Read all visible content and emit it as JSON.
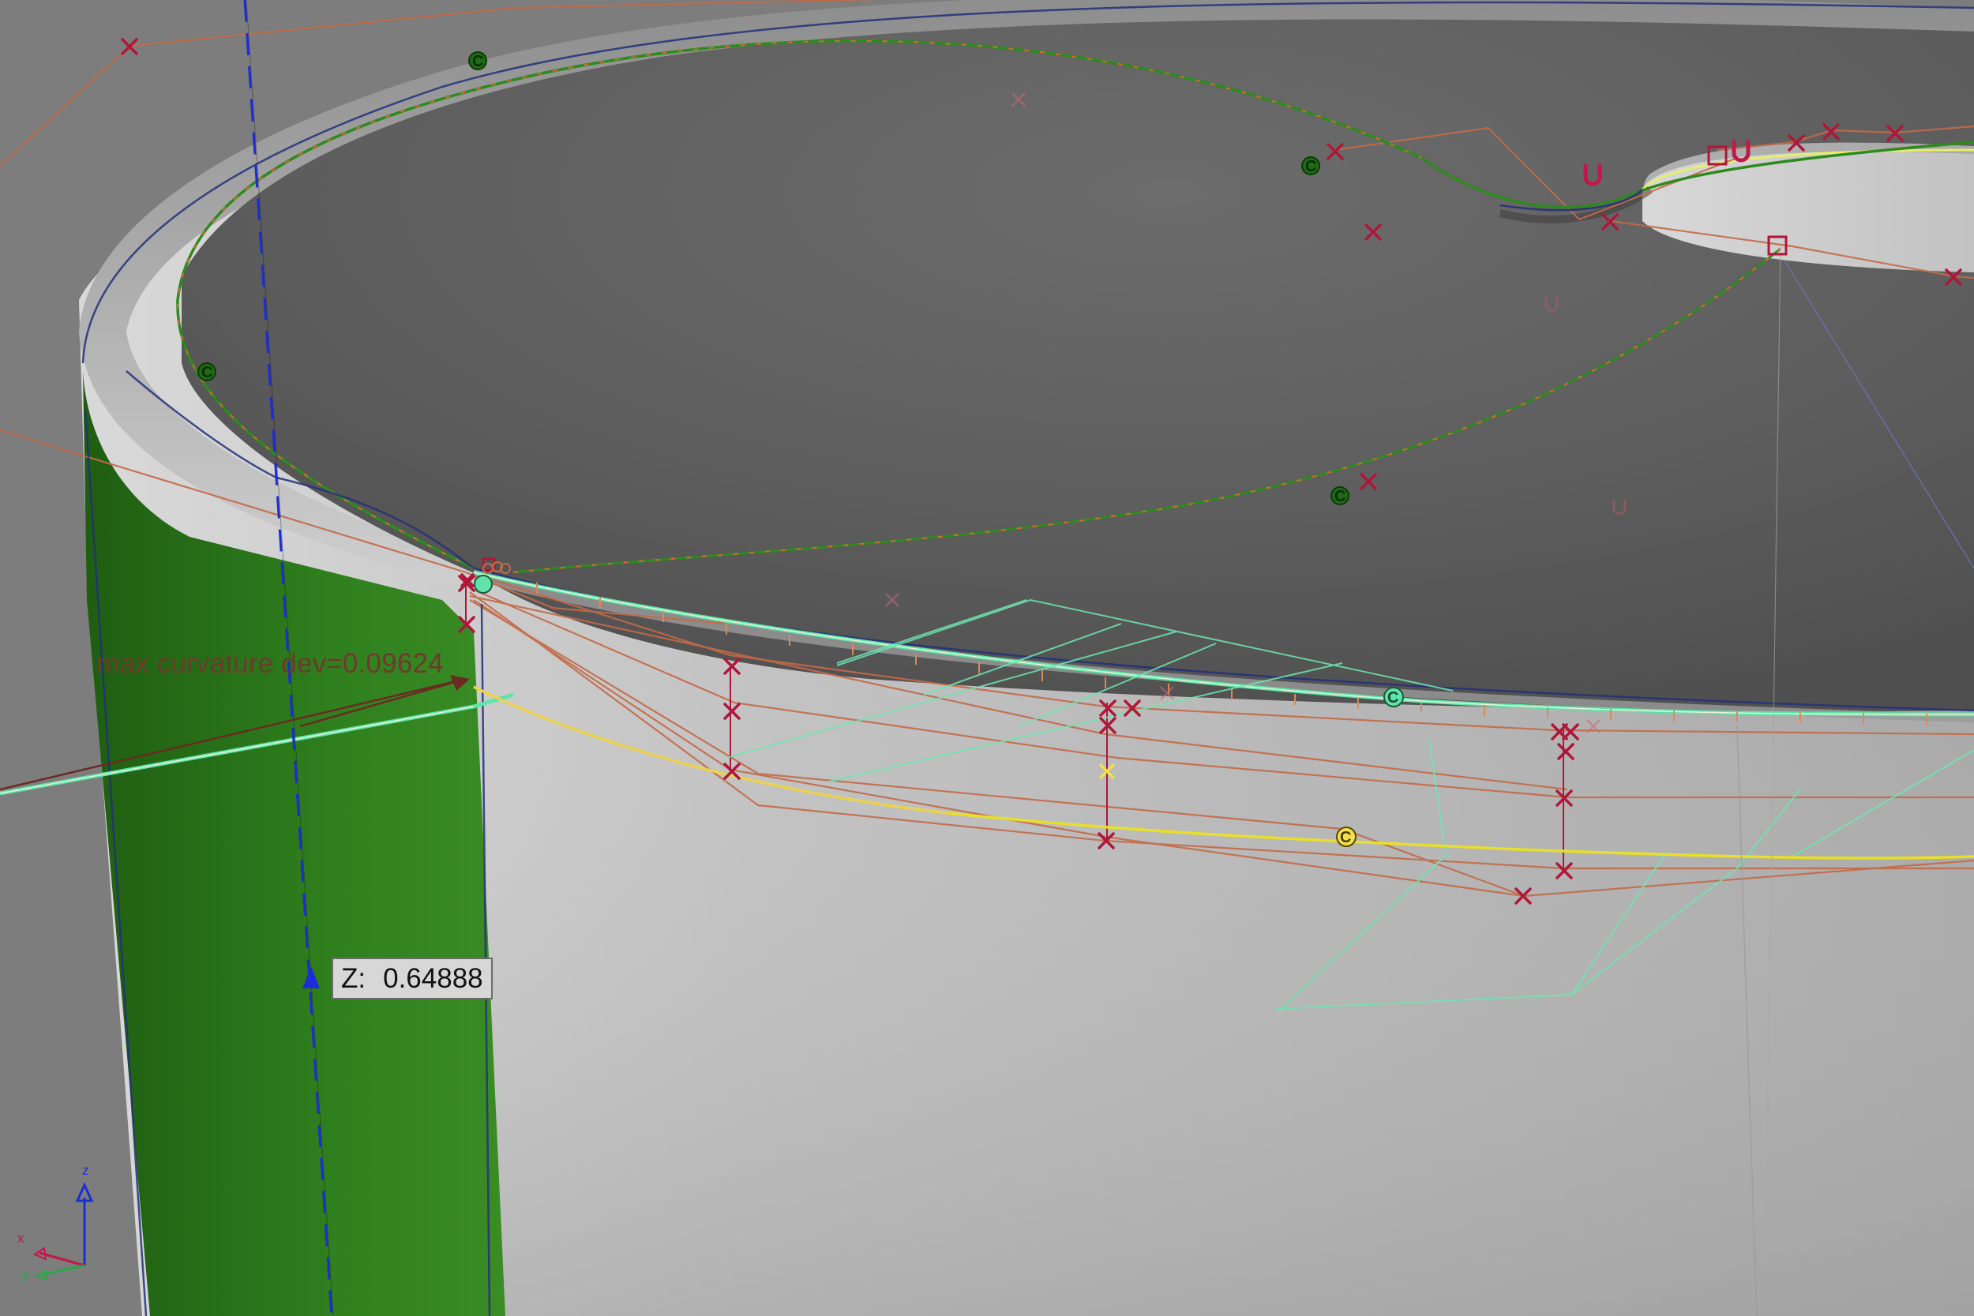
{
  "viewport": {
    "annotation": {
      "curvature_text": "max curvature dev=0.09624"
    },
    "coordinate_readout": {
      "axis_label": "Z:",
      "value": "0.64888"
    },
    "triad": {
      "x_label": "x",
      "y_label": "y",
      "z_label": "z"
    },
    "markers": {
      "cross_glyph": "×",
      "circle_glyph": "C",
      "u_glyph": "U"
    },
    "colors": {
      "background": "#7a7a7a",
      "top_surface": "#6a6a6a",
      "side_wall": "#b4b4b4",
      "green_face": "#2f7f1e",
      "yellow_face": "#6f5e1c",
      "control_polygon": "#c36a48",
      "control_point": "#b0163a",
      "selected_curve": "#5fe3a8",
      "yellow_curve": "#e8df2a",
      "green_curve": "#2e8a1e",
      "axis_blue": "#2030e0"
    },
    "icons": [
      "control-point-cross-icon",
      "curvature-arrow-icon",
      "z-axis-arrow-icon",
      "coordinate-triad-icon"
    ]
  }
}
